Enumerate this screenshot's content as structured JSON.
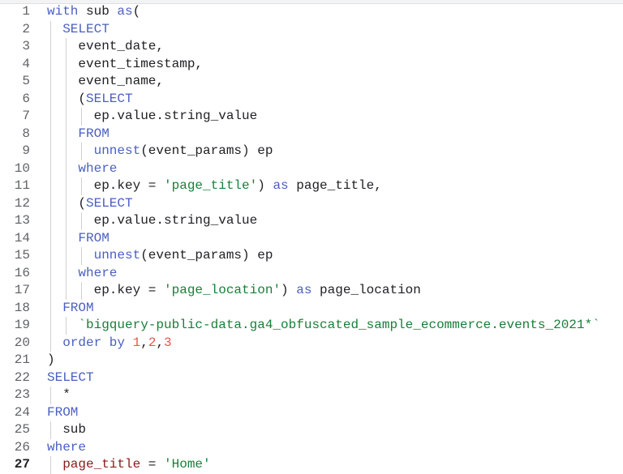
{
  "editor": {
    "current_line": 27,
    "lines": [
      {
        "n": "1",
        "indent": 0,
        "tokens": [
          [
            "kw",
            "with"
          ],
          [
            "id",
            " sub "
          ],
          [
            "kw",
            "as"
          ],
          [
            "op",
            "("
          ]
        ]
      },
      {
        "n": "2",
        "indent": 1,
        "tokens": [
          [
            "kw",
            "SELECT"
          ]
        ]
      },
      {
        "n": "3",
        "indent": 2,
        "tokens": [
          [
            "id",
            "event_date,"
          ]
        ]
      },
      {
        "n": "4",
        "indent": 2,
        "tokens": [
          [
            "id",
            "event_timestamp,"
          ]
        ]
      },
      {
        "n": "5",
        "indent": 2,
        "tokens": [
          [
            "id",
            "event_name,"
          ]
        ]
      },
      {
        "n": "6",
        "indent": 2,
        "tokens": [
          [
            "op",
            "("
          ],
          [
            "kw",
            "SELECT"
          ]
        ]
      },
      {
        "n": "7",
        "indent": 3,
        "tokens": [
          [
            "id",
            "ep.value.string_value"
          ]
        ]
      },
      {
        "n": "8",
        "indent": 2,
        "tokens": [
          [
            "kw",
            "FROM"
          ]
        ]
      },
      {
        "n": "9",
        "indent": 3,
        "tokens": [
          [
            "fn",
            "unnest"
          ],
          [
            "id",
            "(event_params) ep"
          ]
        ]
      },
      {
        "n": "10",
        "indent": 2,
        "tokens": [
          [
            "kw",
            "where"
          ]
        ]
      },
      {
        "n": "11",
        "indent": 3,
        "tokens": [
          [
            "id",
            "ep.key = "
          ],
          [
            "str",
            "'page_title'"
          ],
          [
            "id",
            ") "
          ],
          [
            "kw",
            "as"
          ],
          [
            "id",
            " page_title,"
          ]
        ]
      },
      {
        "n": "12",
        "indent": 2,
        "tokens": [
          [
            "op",
            "("
          ],
          [
            "kw",
            "SELECT"
          ]
        ]
      },
      {
        "n": "13",
        "indent": 3,
        "tokens": [
          [
            "id",
            "ep.value.string_value"
          ]
        ]
      },
      {
        "n": "14",
        "indent": 2,
        "tokens": [
          [
            "kw",
            "FROM"
          ]
        ]
      },
      {
        "n": "15",
        "indent": 3,
        "tokens": [
          [
            "fn",
            "unnest"
          ],
          [
            "id",
            "(event_params) ep"
          ]
        ]
      },
      {
        "n": "16",
        "indent": 2,
        "tokens": [
          [
            "kw",
            "where"
          ]
        ]
      },
      {
        "n": "17",
        "indent": 3,
        "tokens": [
          [
            "id",
            "ep.key = "
          ],
          [
            "str",
            "'page_location'"
          ],
          [
            "id",
            ") "
          ],
          [
            "kw",
            "as"
          ],
          [
            "id",
            " page_location"
          ]
        ]
      },
      {
        "n": "18",
        "indent": 1,
        "tokens": [
          [
            "kw",
            "FROM"
          ]
        ]
      },
      {
        "n": "19",
        "indent": 2,
        "tokens": [
          [
            "str",
            "`bigquery-public-data.ga4_obfuscated_sample_ecommerce.events_2021*`"
          ]
        ]
      },
      {
        "n": "20",
        "indent": 1,
        "tokens": [
          [
            "kw",
            "order by "
          ],
          [
            "num",
            "1"
          ],
          [
            "op",
            ","
          ],
          [
            "num",
            "2"
          ],
          [
            "op",
            ","
          ],
          [
            "num",
            "3"
          ]
        ]
      },
      {
        "n": "21",
        "indent": 0,
        "tokens": [
          [
            "op",
            ")"
          ]
        ]
      },
      {
        "n": "22",
        "indent": 0,
        "tokens": [
          [
            "kw",
            "SELECT"
          ]
        ]
      },
      {
        "n": "23",
        "indent": 1,
        "tokens": [
          [
            "op",
            "*"
          ]
        ]
      },
      {
        "n": "24",
        "indent": 0,
        "tokens": [
          [
            "kw",
            "FROM"
          ]
        ]
      },
      {
        "n": "25",
        "indent": 1,
        "tokens": [
          [
            "id",
            "sub"
          ]
        ]
      },
      {
        "n": "26",
        "indent": 0,
        "tokens": [
          [
            "kw",
            "where"
          ]
        ]
      },
      {
        "n": "27",
        "indent": 1,
        "tokens": [
          [
            "cur-id",
            "page_title"
          ],
          [
            "op",
            " = "
          ],
          [
            "str",
            "'Home'"
          ]
        ]
      }
    ]
  }
}
